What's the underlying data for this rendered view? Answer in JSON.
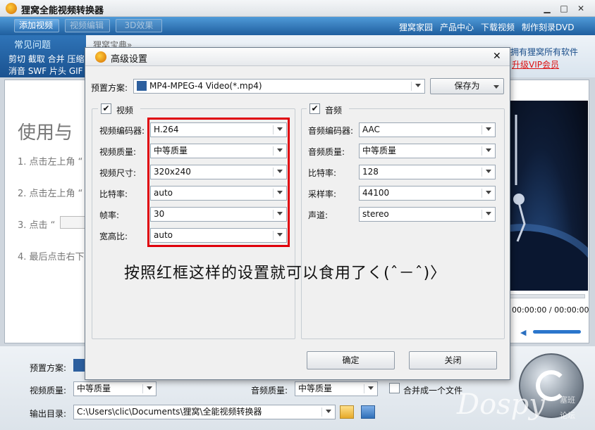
{
  "app": {
    "title": "狸窝全能视频转换器",
    "min": "▁",
    "max": "□",
    "close": "✕"
  },
  "toolbar": {
    "add_video": "添加视频",
    "edit_video": "视频编辑",
    "effect_3d": "3D效果",
    "links": [
      "狸窝家园",
      "产品中心",
      "下载视频",
      "制作刻录DVD"
    ]
  },
  "subbar": {
    "faq": "常见问题",
    "faq_line1": "剪切 截取 合并 压缩",
    "faq_line2": "消音 SWF 片头 GIF",
    "treasure": "狸窝宝典»",
    "vip_line1": "拥有狸窝所有软件",
    "vip_line2": "升级VIP会员"
  },
  "left": {
    "heading": "使用与",
    "steps": [
      "1. 点击左上角 “",
      "2. 点击左上角 “",
      "3. 点击 “",
      "4. 最后点击右下"
    ]
  },
  "player": {
    "time": "00:00:00 / 00:00:00"
  },
  "dialog": {
    "title": "高级设置",
    "close": "✕",
    "preset_label": "预置方案:",
    "preset_value": "MP4-MPEG-4 Video(*.mp4)",
    "save_as": "保存为",
    "video": {
      "label": "视频",
      "checked": "✔",
      "rows": [
        {
          "label": "视频编码器:",
          "value": "H.264"
        },
        {
          "label": "视频质量:",
          "value": "中等质量"
        },
        {
          "label": "视频尺寸:",
          "value": "320x240"
        },
        {
          "label": "比特率:",
          "value": "auto"
        },
        {
          "label": "帧率:",
          "value": "30"
        },
        {
          "label": "宽高比:",
          "value": "auto"
        }
      ]
    },
    "audio": {
      "label": "音频",
      "checked": "✔",
      "rows": [
        {
          "label": "音频编码器:",
          "value": "AAC"
        },
        {
          "label": "音频质量:",
          "value": "中等质量"
        },
        {
          "label": "比特率:",
          "value": "128"
        },
        {
          "label": "采样率:",
          "value": "44100"
        },
        {
          "label": "声道:",
          "value": "stereo"
        }
      ]
    },
    "ok": "确定",
    "cancel": "关闭",
    "note": "按照红框这样的设置就可以食用了く(ˆ－ˆ)〉"
  },
  "bottom": {
    "preset_label": "预置方案:",
    "video_quality_label": "视频质量:",
    "video_quality_value": "中等质量",
    "audio_quality_label": "音频质量:",
    "audio_quality_value": "中等质量",
    "merge_label": "合并成一个文件",
    "output_label": "输出目录:",
    "output_value": "C:\\Users\\clic\\Documents\\狸窝\\全能视频转换器"
  },
  "watermark": {
    "text": "Dospy",
    "sub1": "塞班",
    "sub2": "论坛"
  },
  "colors": {
    "accent": "#1f5e9e",
    "highlight": "#e0000b"
  }
}
